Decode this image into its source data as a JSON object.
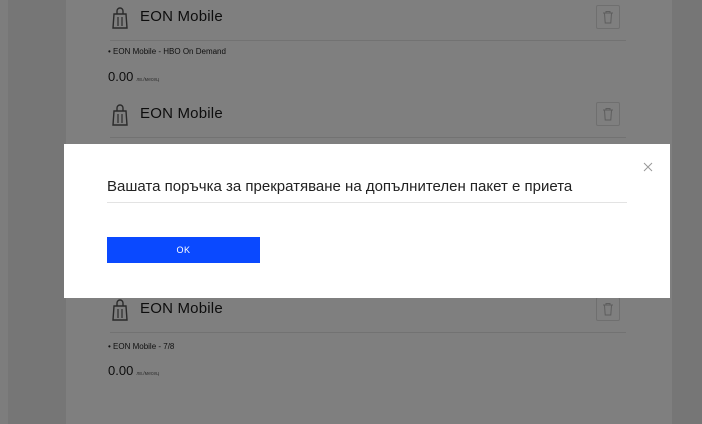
{
  "products": [
    {
      "title": "EON Mobile",
      "icon": "shopping-bag-icon",
      "trash_icon": "trash-icon"
    },
    {
      "title": "EON Mobile",
      "icon": "shopping-bag-icon",
      "trash_icon": "trash-icon"
    },
    {
      "title": "EON Mobile",
      "icon": "shopping-bag-icon",
      "trash_icon": "trash-icon"
    }
  ],
  "line_items": [
    {
      "text": "• EON Mobile - HBO On Demand",
      "price": "0.00",
      "unit": "лв./месец"
    },
    {
      "text": "• EON Mobile - 7/8",
      "price": "0.00",
      "unit": "лв./месец"
    }
  ],
  "modal": {
    "message": "Вашата поръчка за прекратяване на допълнителен пакет е приета",
    "ok_label": "OK",
    "close_icon": "close-icon",
    "button_color": "#0a49ff"
  }
}
